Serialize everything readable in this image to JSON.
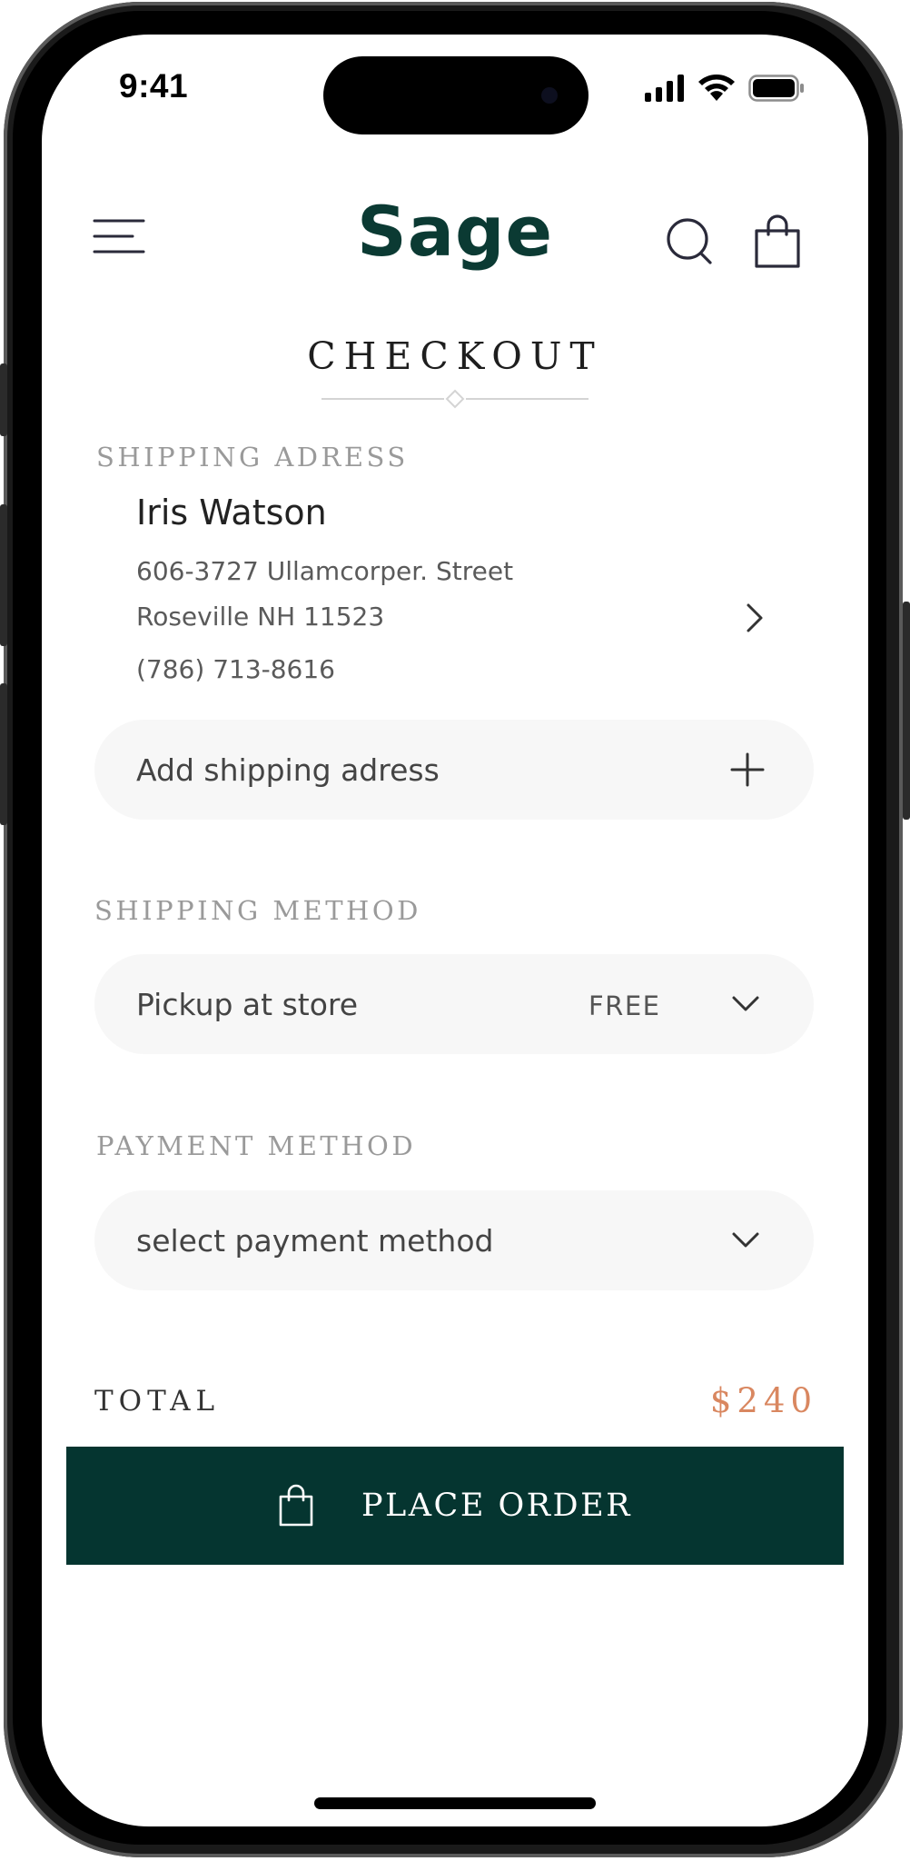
{
  "status_bar": {
    "time": "9:41",
    "icons": [
      "cellular-signal-icon",
      "wifi-icon",
      "battery-icon"
    ]
  },
  "header": {
    "brand": "Sage",
    "icons": [
      "hamburger-menu-icon",
      "search-icon",
      "shopping-bag-icon"
    ]
  },
  "page": {
    "title": "CHECKOUT"
  },
  "shipping_address": {
    "label": "SHIPPING ADRESS",
    "name": "Iris Watson",
    "street": "606-3727 Ullamcorper. Street",
    "city_line": "Roseville NH 11523",
    "phone": "(786) 713-8616",
    "add_label": "Add shipping adress"
  },
  "shipping_method": {
    "label": "SHIPPING METHOD",
    "selected": "Pickup at store",
    "price": "FREE"
  },
  "payment_method": {
    "label": "PAYMENT METHOD",
    "placeholder": "select payment method"
  },
  "total": {
    "label": "TOTAL",
    "value": "$240"
  },
  "actions": {
    "place_order": "PLACE ORDER"
  },
  "colors": {
    "brand_green": "#0b3a33",
    "button_green": "#053530",
    "price_accent": "#d98760",
    "label_gray": "#9a9a9a",
    "pill_bg": "#f7f7f7"
  }
}
